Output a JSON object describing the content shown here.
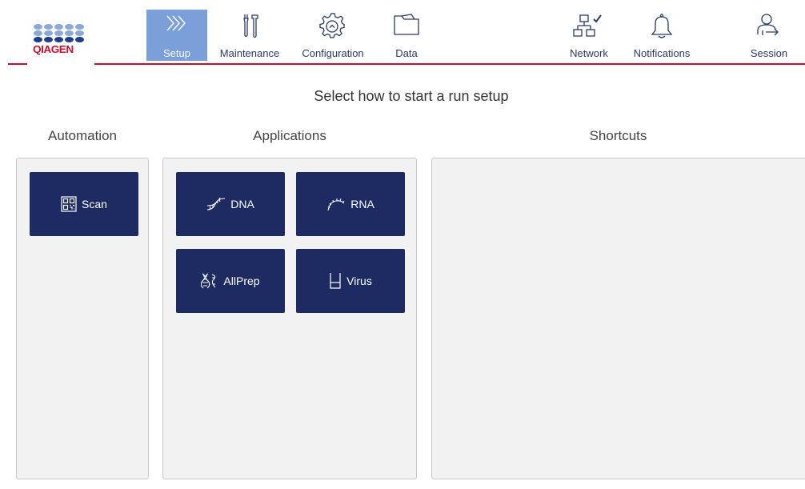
{
  "header": {
    "logo_text": "QIAGEN",
    "nav": {
      "setup": "Setup",
      "maintenance": "Maintenance",
      "configuration": "Configuration",
      "data": "Data",
      "network": "Network",
      "notifications": "Notifications",
      "session": "Session"
    },
    "active_tab": "Setup",
    "icons": {
      "setup": "chevrons-right-icon",
      "maintenance": "tools-icon",
      "configuration": "gear-icon",
      "data": "folder-icon",
      "network": "network-connected-icon",
      "notifications": "bell-icon",
      "session": "user-logout-icon"
    }
  },
  "main": {
    "title": "Select how to start a run setup",
    "columns": {
      "automation": {
        "heading": "Automation",
        "tiles": [
          {
            "label": "Scan",
            "icon": "qr-code-icon"
          }
        ]
      },
      "applications": {
        "heading": "Applications",
        "tiles": [
          {
            "label": "DNA",
            "icon": "dna-icon"
          },
          {
            "label": "RNA",
            "icon": "rna-icon"
          },
          {
            "label": "AllPrep",
            "icon": "allprep-icon"
          },
          {
            "label": "Virus",
            "icon": "tube-icon"
          }
        ]
      },
      "shortcuts": {
        "heading": "Shortcuts",
        "tiles": []
      }
    }
  },
  "colors": {
    "brand_red": "#c8102e",
    "brand_blue": "#1e3c8c",
    "logo_light_blue": "#8aa8d8",
    "tile_bg": "#1e2b62",
    "active_tab_bg": "#7a9fd9",
    "panel_bg": "#f2f2f2"
  }
}
